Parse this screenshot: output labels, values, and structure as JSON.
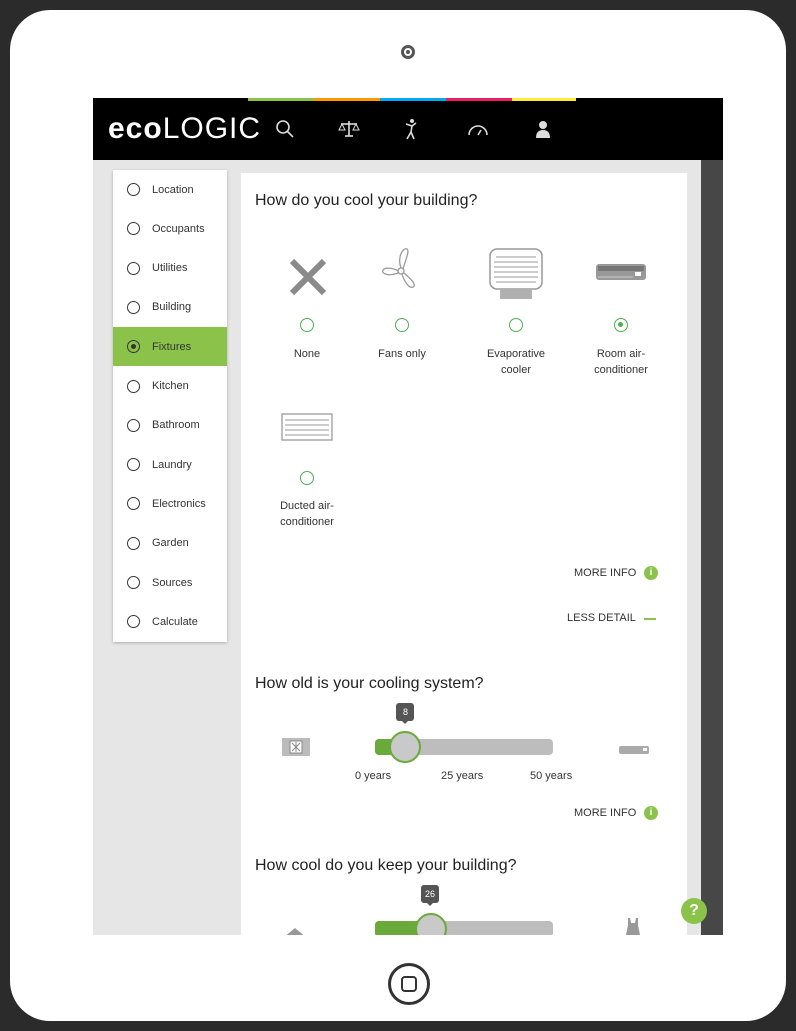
{
  "app": {
    "logo_bold": "eco",
    "logo_light": "LOGIC",
    "nav_icons": [
      "search-icon",
      "scales-icon",
      "person-icon",
      "gauge-icon",
      "user-icon"
    ]
  },
  "sidebar": {
    "items": [
      {
        "label": "Location",
        "active": false
      },
      {
        "label": "Occupants",
        "active": false
      },
      {
        "label": "Utilities",
        "active": false
      },
      {
        "label": "Building",
        "active": false
      },
      {
        "label": "Fixtures",
        "active": true
      },
      {
        "label": "Kitchen",
        "active": false
      },
      {
        "label": "Bathroom",
        "active": false
      },
      {
        "label": "Laundry",
        "active": false
      },
      {
        "label": "Electronics",
        "active": false
      },
      {
        "label": "Garden",
        "active": false
      },
      {
        "label": "Sources",
        "active": false
      },
      {
        "label": "Calculate",
        "active": false
      }
    ]
  },
  "q1": {
    "title": "How do you cool your building?",
    "options": [
      {
        "label": "None",
        "icon": "x-icon",
        "selected": false
      },
      {
        "label": "Fans only",
        "icon": "fan-icon",
        "selected": false
      },
      {
        "label": "Evaporative cooler",
        "icon": "evaporative-cooler-icon",
        "selected": false
      },
      {
        "label": "Room air-conditioner",
        "icon": "room-ac-icon",
        "selected": true
      },
      {
        "label": "Ducted air-conditioner",
        "icon": "ducted-ac-icon",
        "selected": false
      }
    ],
    "more_info": "MORE INFO",
    "less_detail": "LESS DETAIL"
  },
  "q2": {
    "title": "How old is your cooling system?",
    "value": "8",
    "value_fraction": 0.16,
    "ticks": [
      "0 years",
      "25 years",
      "50 years"
    ],
    "more_info": "MORE INFO"
  },
  "q3": {
    "title": "How cool do you keep your building?",
    "value": "26"
  },
  "help": "?",
  "colors": {
    "accent": "#8bc34a",
    "radio": "#4caf50",
    "nav_bar": [
      "#8bc34a",
      "#ff9800",
      "#03a9f4",
      "#e91e63",
      "#ffeb3b"
    ]
  }
}
